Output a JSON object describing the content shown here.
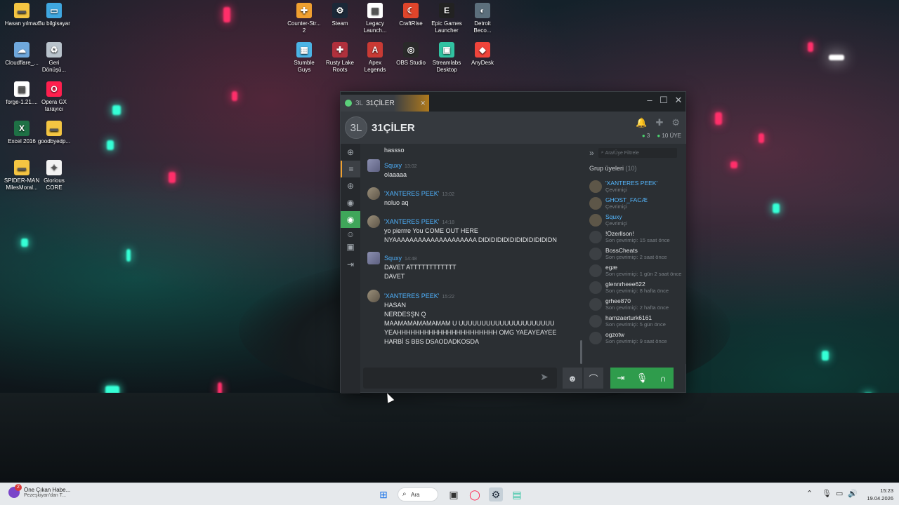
{
  "desktop": {
    "icons": [
      {
        "label": "Hasan yılmaz",
        "icon": "folder-icon",
        "color": "#f4c542"
      },
      {
        "label": "Bu bilgisayar",
        "icon": "computer-icon",
        "color": "#3fa7e0"
      },
      {
        "label": "Cloudflare_...",
        "icon": "cloudflare-icon",
        "color": "#6fa8dc"
      },
      {
        "label": "Geri\nDönüşü...",
        "icon": "recycle-bin-icon",
        "color": "#b9c3cc"
      },
      {
        "label": "forge-1.21....",
        "icon": "file-icon",
        "color": "#ffffff"
      },
      {
        "label": "Opera GX\ntarayıcı",
        "icon": "opera-gx-icon",
        "color": "#ff1f4e"
      },
      {
        "label": "Excel 2016",
        "icon": "excel-icon",
        "color": "#1e7145"
      },
      {
        "label": "goodbyedp...",
        "icon": "folder-icon",
        "color": "#f4c542"
      },
      {
        "label": "SPIDER-MAN\nMilesMoral...",
        "icon": "folder-icon",
        "color": "#f4c542"
      },
      {
        "label": "Glorious\nCORE",
        "icon": "glorious-icon",
        "color": "#f2f2f2"
      },
      {
        "label": "Counter-Str...\n2",
        "icon": "counter-strike-icon",
        "color": "#f0a030"
      },
      {
        "label": "Steam",
        "icon": "steam-icon",
        "color": "#1b2838"
      },
      {
        "label": "Legacy\nLaunch...",
        "icon": "file-icon",
        "color": "#ffffff"
      },
      {
        "label": "CraftRise",
        "icon": "craftrise-icon",
        "color": "#e0452b"
      },
      {
        "label": "Epic Games\nLauncher",
        "icon": "epic-games-icon",
        "color": "#222222"
      },
      {
        "label": "Detroit\nBeco...",
        "icon": "detroit-icon",
        "color": "#5c6f7c"
      },
      {
        "label": "Stumble\nGuys",
        "icon": "stumble-guys-icon",
        "color": "#4bb4e6"
      },
      {
        "label": "Rusty Lake\nRoots",
        "icon": "rusty-lake-icon",
        "color": "#b0303c"
      },
      {
        "label": "Apex\nLegends",
        "icon": "apex-icon",
        "color": "#c93a34"
      },
      {
        "label": "OBS Studio",
        "icon": "obs-icon",
        "color": "#2a2a2a"
      },
      {
        "label": "Streamlabs\nDesktop",
        "icon": "streamlabs-icon",
        "color": "#31c3a2"
      },
      {
        "label": "AnyDesk",
        "icon": "anydesk-icon",
        "color": "#ef443b"
      }
    ]
  },
  "window": {
    "tab_short": "3L",
    "tab_title": "31ÇİLER",
    "group_avatar": "3L",
    "group_title": "31ÇİLER",
    "online_count": "3",
    "member_count": "10 ÜYE",
    "messages": [
      {
        "author": "",
        "time": "",
        "lines": [
          "hassso"
        ]
      },
      {
        "author": "Squxy",
        "time": "13:02",
        "lines": [
          "olaaaaa"
        ]
      },
      {
        "author": "'XANTERES PEEK'",
        "time": "13:02",
        "lines": [
          "noluo aq"
        ]
      },
      {
        "author": "'XANTERES PEEK'",
        "time": "14:18",
        "lines": [
          "yo pierrre You COME OUT HERE",
          "NYAAAAAAAAAAAAAAAAAAAA DIDIDIDIDIDIDIDIDIDIDIDN"
        ]
      },
      {
        "author": "Squxy",
        "time": "14:48",
        "lines": [
          "DAVET ATTTTTTTTTTTT",
          "DAVET"
        ]
      },
      {
        "author": "'XANTERES PEEK'",
        "time": "15:22",
        "lines": [
          "HASAN",
          "NERDESŞN Q",
          "MAAMAMAMAMAMAM U UUUUUUUUUUUUUUUUUUUUU",
          "YEAHHHHHHHHHHHHHHHHHHHHHH OMG YAEAYEAYEE",
          "HARBİ S BBS DSAODADKOSDA"
        ]
      }
    ],
    "members_filter_placeholder": "Ara/Üye Filtrele",
    "members_header": "Grup üyeleri",
    "members_header_count": "(10)",
    "members": [
      {
        "name": "'XANTERES PEEK'",
        "status": "Çevrimiçi",
        "online": true
      },
      {
        "name": "GHOST_FACÆ",
        "status": "Çevrimiçi",
        "online": true
      },
      {
        "name": "Squxy",
        "status": "Çevrimiçi",
        "online": true
      },
      {
        "name": "!Özerllson!",
        "status": "Son çevrimiçi: 15 saat önce",
        "online": false
      },
      {
        "name": "BossCheats",
        "status": "Son çevrimiçi: 2 saat önce",
        "online": false
      },
      {
        "name": "egæ",
        "status": "Son çevrimiçi: 1 gün 2 saat önce",
        "online": false
      },
      {
        "name": "glennrheee622",
        "status": "Son çevrimiçi: 8 hafta önce",
        "online": false
      },
      {
        "name": "grhee870",
        "status": "Son çevrimiçi: 2 hafta önce",
        "online": false
      },
      {
        "name": "hamzaerturk6161",
        "status": "Son çevrimiçi: 5 gün önce",
        "online": false
      },
      {
        "name": "ogzotw",
        "status": "Son çevrimiçi: 9 saat önce",
        "online": false
      }
    ]
  },
  "taskbar": {
    "news_title": "Öne Çıkan Habe...",
    "news_subtitle": "Pezeşkiyan'dan T...",
    "news_badge": "2",
    "search_label": "Ara",
    "time": "15:23",
    "date": "19.04.2026"
  },
  "colors": {
    "accent_online": "#4fb3ff",
    "green_button": "#2f9c4c"
  }
}
